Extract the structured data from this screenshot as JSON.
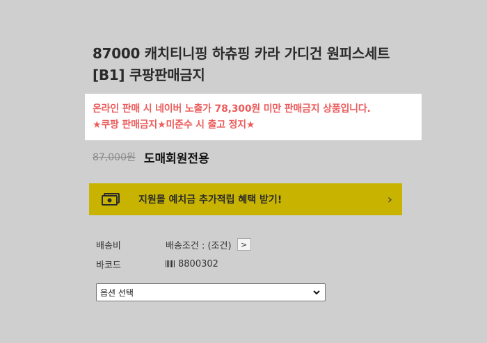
{
  "product": {
    "title_line1": "87000 캐치티니핑 하츄핑 카라 가디건 원피스세트",
    "title_line2": "[B1] 쿠팡판매금지",
    "notice_line1": "온라인 판매 시 네이버 노출가 78,300원 미만 판매금지 상품입니다.",
    "notice_line2": "★쿠팡 판매금지★미준수 시 출고 정지★",
    "old_price": "87,000원",
    "member_price": "도매회원전용"
  },
  "banner": {
    "icon": "money-icon",
    "text": "지원몰 예치금 추가적립 혜택 받기!",
    "chevron": "›"
  },
  "info": {
    "shipping_label": "배송비",
    "shipping_value": "배송조건 : (조건)",
    "shipping_button": ">",
    "barcode_label": "바코드",
    "barcode_icon": "barcode-icon",
    "barcode_value": "8800302"
  },
  "option_select": {
    "selected": "옵션 선택"
  },
  "colors": {
    "background": "#cfcfcf",
    "notice_text": "#ec5c5c",
    "banner_bg": "#c8b400"
  }
}
